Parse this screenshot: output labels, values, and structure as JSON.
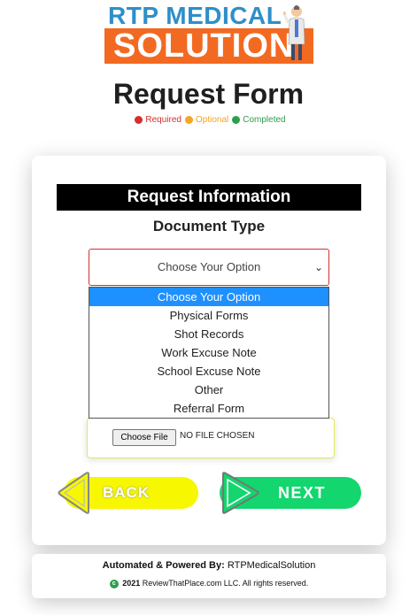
{
  "logo": {
    "top_text": "RTP MEDICAL",
    "bottom_text": "SOLUTION"
  },
  "page_title": "Request Form",
  "legend": [
    {
      "label": "Required",
      "color": "#d32f2f"
    },
    {
      "label": "Optional",
      "color": "#f5a623"
    },
    {
      "label": "Completed",
      "color": "#2e9e4d"
    }
  ],
  "section_header": "Request Information",
  "document_type_label": "Document Type",
  "select": {
    "value": "Choose Your Option"
  },
  "dropdown_options": [
    "Choose Your Option",
    "Physical Forms",
    "Shot Records",
    "Work Excuse Note",
    "School Excuse Note",
    "Other",
    "Referral Form"
  ],
  "file_input": {
    "button_label": "Choose File",
    "status": "NO FILE CHOSEN"
  },
  "buttons": {
    "back_label": "BACK",
    "next_label": "NEXT"
  },
  "footer": {
    "powered_label": "Automated & Powered By:",
    "powered_name": "RTPMedicalSolution",
    "copyright_year": "2021",
    "copyright_text": "ReviewThatPlace.com LLC. All rights reserved."
  },
  "colors": {
    "accent_required": "#d32f2f",
    "back_button": "#f7f700",
    "next_button": "#13d66e",
    "dropdown_highlight": "#1e90ff"
  }
}
